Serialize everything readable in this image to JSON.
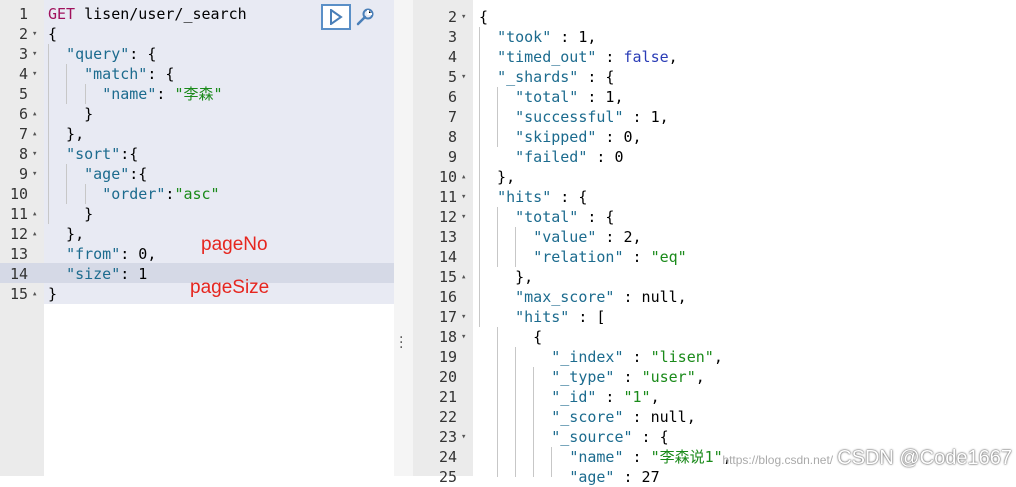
{
  "request": {
    "lines": [
      {
        "n": "1",
        "fold": "",
        "t": [
          [
            "m",
            "GET "
          ],
          [
            "n",
            "lisen/user/_search"
          ]
        ]
      },
      {
        "n": "2",
        "fold": "▾",
        "t": [
          [
            "n",
            "{"
          ]
        ]
      },
      {
        "n": "3",
        "fold": "▾",
        "t": [
          [
            "n",
            "  "
          ],
          [
            "k",
            "\"query\""
          ],
          [
            "n",
            ": {"
          ]
        ]
      },
      {
        "n": "4",
        "fold": "▾",
        "t": [
          [
            "n",
            "    "
          ],
          [
            "k",
            "\"match\""
          ],
          [
            "n",
            ": {"
          ]
        ]
      },
      {
        "n": "5",
        "fold": "",
        "t": [
          [
            "n",
            "      "
          ],
          [
            "k",
            "\"name\""
          ],
          [
            "n",
            ": "
          ],
          [
            "s",
            "\"李森\""
          ]
        ]
      },
      {
        "n": "6",
        "fold": "▴",
        "t": [
          [
            "n",
            "    }"
          ]
        ]
      },
      {
        "n": "7",
        "fold": "▴",
        "t": [
          [
            "n",
            "  },"
          ]
        ]
      },
      {
        "n": "8",
        "fold": "▾",
        "t": [
          [
            "n",
            "  "
          ],
          [
            "k",
            "\"sort\""
          ],
          [
            "n",
            ":{"
          ]
        ]
      },
      {
        "n": "9",
        "fold": "▾",
        "t": [
          [
            "n",
            "    "
          ],
          [
            "k",
            "\"age\""
          ],
          [
            "n",
            ":{"
          ]
        ]
      },
      {
        "n": "10",
        "fold": "",
        "t": [
          [
            "n",
            "      "
          ],
          [
            "k",
            "\"order\""
          ],
          [
            "n",
            ":"
          ],
          [
            "s",
            "\"asc\""
          ]
        ]
      },
      {
        "n": "11",
        "fold": "▴",
        "t": [
          [
            "n",
            "    }"
          ]
        ]
      },
      {
        "n": "12",
        "fold": "▴",
        "t": [
          [
            "n",
            "  },"
          ]
        ]
      },
      {
        "n": "13",
        "fold": "",
        "t": [
          [
            "n",
            "  "
          ],
          [
            "k",
            "\"from\""
          ],
          [
            "n",
            ": 0,"
          ]
        ]
      },
      {
        "n": "14",
        "fold": "",
        "t": [
          [
            "n",
            "  "
          ],
          [
            "k",
            "\"size\""
          ],
          [
            "n",
            ": 1"
          ]
        ]
      },
      {
        "n": "15",
        "fold": "▴",
        "t": [
          [
            "n",
            "}"
          ]
        ]
      }
    ]
  },
  "response": {
    "lines": [
      {
        "n": "2",
        "fold": "▾",
        "t": [
          [
            "n",
            "{"
          ]
        ]
      },
      {
        "n": "3",
        "fold": "",
        "t": [
          [
            "n",
            "  "
          ],
          [
            "k",
            "\"took\""
          ],
          [
            "n",
            " : 1,"
          ]
        ]
      },
      {
        "n": "4",
        "fold": "",
        "t": [
          [
            "n",
            "  "
          ],
          [
            "k",
            "\"timed_out\""
          ],
          [
            "n",
            " : "
          ],
          [
            "b",
            "false"
          ],
          [
            "n",
            ","
          ]
        ]
      },
      {
        "n": "5",
        "fold": "▾",
        "t": [
          [
            "n",
            "  "
          ],
          [
            "k",
            "\"_shards\""
          ],
          [
            "n",
            " : {"
          ]
        ]
      },
      {
        "n": "6",
        "fold": "",
        "t": [
          [
            "n",
            "    "
          ],
          [
            "k",
            "\"total\""
          ],
          [
            "n",
            " : 1,"
          ]
        ]
      },
      {
        "n": "7",
        "fold": "",
        "t": [
          [
            "n",
            "    "
          ],
          [
            "k",
            "\"successful\""
          ],
          [
            "n",
            " : 1,"
          ]
        ]
      },
      {
        "n": "8",
        "fold": "",
        "t": [
          [
            "n",
            "    "
          ],
          [
            "k",
            "\"skipped\""
          ],
          [
            "n",
            " : 0,"
          ]
        ]
      },
      {
        "n": "9",
        "fold": "",
        "t": [
          [
            "n",
            "    "
          ],
          [
            "k",
            "\"failed\""
          ],
          [
            "n",
            " : 0"
          ]
        ]
      },
      {
        "n": "10",
        "fold": "▴",
        "t": [
          [
            "n",
            "  },"
          ]
        ]
      },
      {
        "n": "11",
        "fold": "▾",
        "t": [
          [
            "n",
            "  "
          ],
          [
            "k",
            "\"hits\""
          ],
          [
            "n",
            " : {"
          ]
        ]
      },
      {
        "n": "12",
        "fold": "▾",
        "t": [
          [
            "n",
            "    "
          ],
          [
            "k",
            "\"total\""
          ],
          [
            "n",
            " : {"
          ]
        ]
      },
      {
        "n": "13",
        "fold": "",
        "t": [
          [
            "n",
            "      "
          ],
          [
            "k",
            "\"value\""
          ],
          [
            "n",
            " : 2,"
          ]
        ]
      },
      {
        "n": "14",
        "fold": "",
        "t": [
          [
            "n",
            "      "
          ],
          [
            "k",
            "\"relation\""
          ],
          [
            "n",
            " : "
          ],
          [
            "s",
            "\"eq\""
          ]
        ]
      },
      {
        "n": "15",
        "fold": "▴",
        "t": [
          [
            "n",
            "    },"
          ]
        ]
      },
      {
        "n": "16",
        "fold": "",
        "t": [
          [
            "n",
            "    "
          ],
          [
            "k",
            "\"max_score\""
          ],
          [
            "n",
            " : null,"
          ]
        ]
      },
      {
        "n": "17",
        "fold": "▾",
        "t": [
          [
            "n",
            "    "
          ],
          [
            "k",
            "\"hits\""
          ],
          [
            "n",
            " : ["
          ]
        ]
      },
      {
        "n": "18",
        "fold": "▾",
        "t": [
          [
            "n",
            "      {"
          ]
        ]
      },
      {
        "n": "19",
        "fold": "",
        "t": [
          [
            "n",
            "        "
          ],
          [
            "k",
            "\"_index\""
          ],
          [
            "n",
            " : "
          ],
          [
            "s",
            "\"lisen\""
          ],
          [
            "n",
            ","
          ]
        ]
      },
      {
        "n": "20",
        "fold": "",
        "t": [
          [
            "n",
            "        "
          ],
          [
            "k",
            "\"_type\""
          ],
          [
            "n",
            " : "
          ],
          [
            "s",
            "\"user\""
          ],
          [
            "n",
            ","
          ]
        ]
      },
      {
        "n": "21",
        "fold": "",
        "t": [
          [
            "n",
            "        "
          ],
          [
            "k",
            "\"_id\""
          ],
          [
            "n",
            " : "
          ],
          [
            "s",
            "\"1\""
          ],
          [
            "n",
            ","
          ]
        ]
      },
      {
        "n": "22",
        "fold": "",
        "t": [
          [
            "n",
            "        "
          ],
          [
            "k",
            "\"_score\""
          ],
          [
            "n",
            " : null,"
          ]
        ]
      },
      {
        "n": "23",
        "fold": "▾",
        "t": [
          [
            "n",
            "        "
          ],
          [
            "k",
            "\"_source\""
          ],
          [
            "n",
            " : {"
          ]
        ]
      },
      {
        "n": "24",
        "fold": "",
        "t": [
          [
            "n",
            "          "
          ],
          [
            "k",
            "\"name\""
          ],
          [
            "n",
            " : "
          ],
          [
            "s",
            "\"李森说1\""
          ],
          [
            "n",
            ","
          ]
        ]
      },
      {
        "n": "25",
        "fold": "",
        "t": [
          [
            "n",
            "          "
          ],
          [
            "k",
            "\"age\""
          ],
          [
            "n",
            " : 27"
          ]
        ]
      }
    ]
  },
  "annotations": {
    "page_no": "pageNo",
    "page_size": "pageSize"
  },
  "watermark": {
    "url": "https://blog.csdn.net/",
    "label": "CSDN @Code1667"
  },
  "icons": {
    "run": "play-icon",
    "settings": "wrench-icon",
    "resize": "vertical-dots-icon"
  },
  "colors": {
    "key": "#1c6b8e",
    "string": "#1a8a1a",
    "method": "#a0115d",
    "boolean": "#2a3cb6",
    "annotation": "#e6261f",
    "run_border": "#5a8fc7"
  }
}
